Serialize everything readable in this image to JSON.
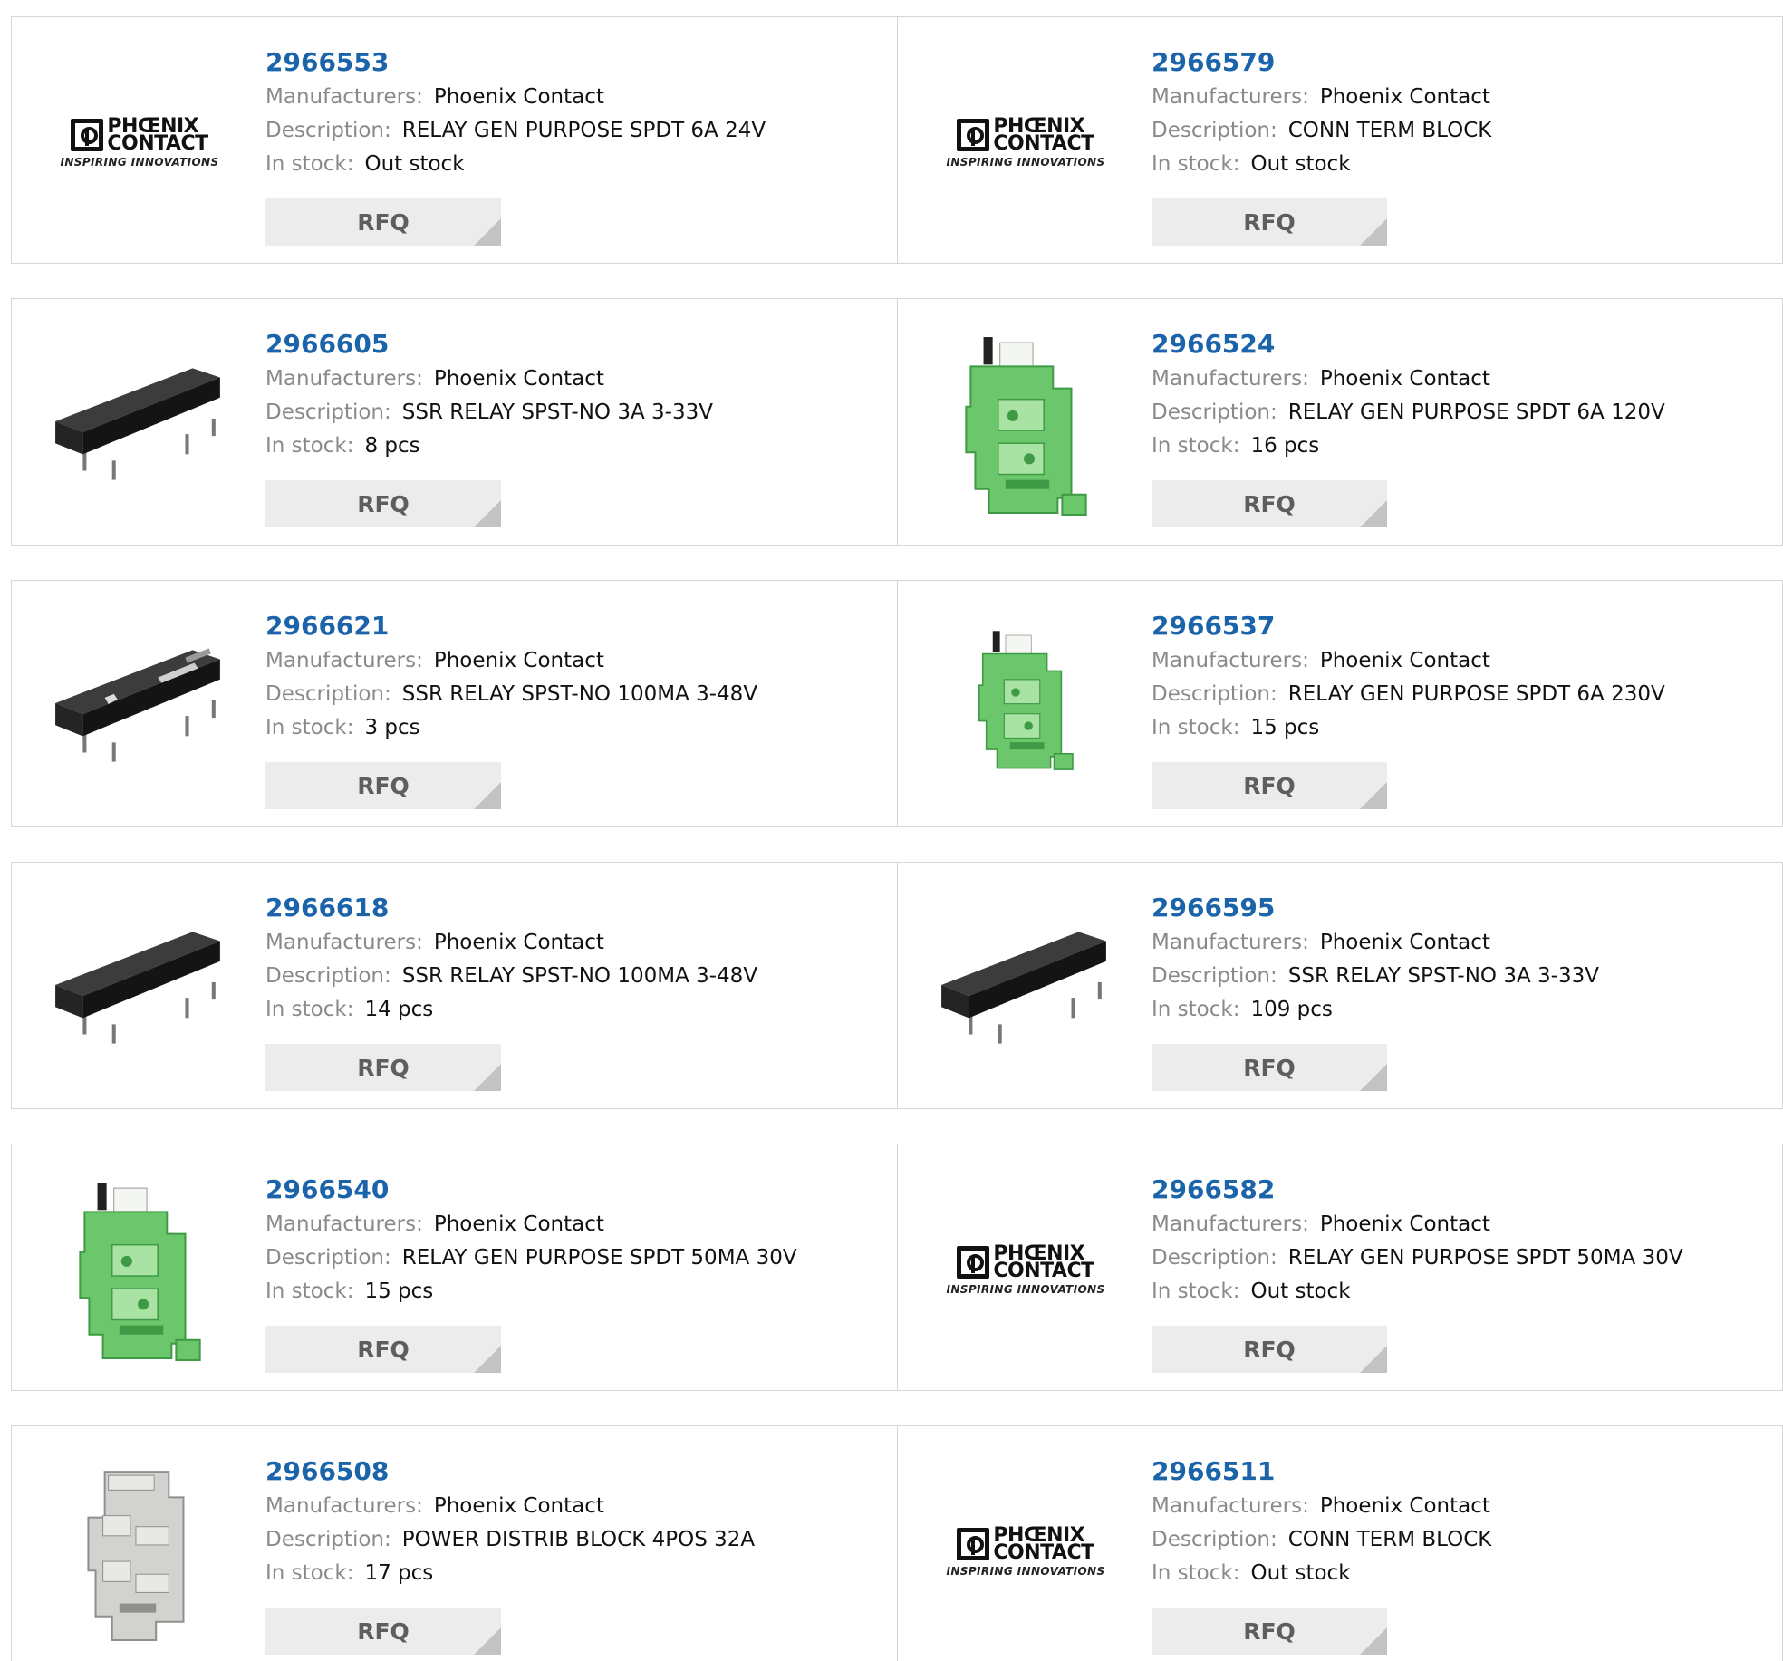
{
  "labels": {
    "manufacturers": "Manufacturers:",
    "description": "Description:",
    "stock": "In stock:",
    "rfq": "RFQ"
  },
  "logo": {
    "line1": "PHŒNIX",
    "line2": "CONTACT",
    "tagline": "INSPIRING INNOVATIONS"
  },
  "products": [
    {
      "pn": "2966553",
      "manufacturer": "Phoenix Contact",
      "description": "RELAY GEN PURPOSE SPDT 6A 24V",
      "stock": "Out stock",
      "image": "logo"
    },
    {
      "pn": "2966579",
      "manufacturer": "Phoenix Contact",
      "description": "CONN TERM BLOCK",
      "stock": "Out stock",
      "image": "logo"
    },
    {
      "pn": "2966605",
      "manufacturer": "Phoenix Contact",
      "description": "SSR RELAY SPST-NO 3A 3-33V",
      "stock": "8 pcs",
      "image": "black-relay"
    },
    {
      "pn": "2966524",
      "manufacturer": "Phoenix Contact",
      "description": "RELAY GEN PURPOSE SPDT 6A 120V",
      "stock": "16 pcs",
      "image": "green-relay"
    },
    {
      "pn": "2966621",
      "manufacturer": "Phoenix Contact",
      "description": "SSR RELAY SPST-NO 100MA 3-48V",
      "stock": "3 pcs",
      "image": "black-relay-marked"
    },
    {
      "pn": "2966537",
      "manufacturer": "Phoenix Contact",
      "description": "RELAY GEN PURPOSE SPDT 6A 230V",
      "stock": "15 pcs",
      "image": "green-relay-small"
    },
    {
      "pn": "2966618",
      "manufacturer": "Phoenix Contact",
      "description": "SSR RELAY SPST-NO 100MA 3-48V",
      "stock": "14 pcs",
      "image": "black-relay"
    },
    {
      "pn": "2966595",
      "manufacturer": "Phoenix Contact",
      "description": "SSR RELAY SPST-NO 3A 3-33V",
      "stock": "109 pcs",
      "image": "black-relay"
    },
    {
      "pn": "2966540",
      "manufacturer": "Phoenix Contact",
      "description": "RELAY GEN PURPOSE SPDT 50MA 30V",
      "stock": "15 pcs",
      "image": "green-relay"
    },
    {
      "pn": "2966582",
      "manufacturer": "Phoenix Contact",
      "description": "RELAY GEN PURPOSE SPDT 50MA 30V",
      "stock": "Out stock",
      "image": "logo"
    },
    {
      "pn": "2966508",
      "manufacturer": "Phoenix Contact",
      "description": "POWER DISTRIB BLOCK 4POS 32A",
      "stock": "17 pcs",
      "image": "grey-block"
    },
    {
      "pn": "2966511",
      "manufacturer": "Phoenix Contact",
      "description": "CONN TERM BLOCK",
      "stock": "Out stock",
      "image": "logo"
    }
  ],
  "colors": {
    "part_number_link": "#1b64aa",
    "label_gray": "#8a8a8a",
    "border": "#d5d5d5",
    "rfq_background": "#ececec",
    "relay_green": "#6cc76c"
  }
}
